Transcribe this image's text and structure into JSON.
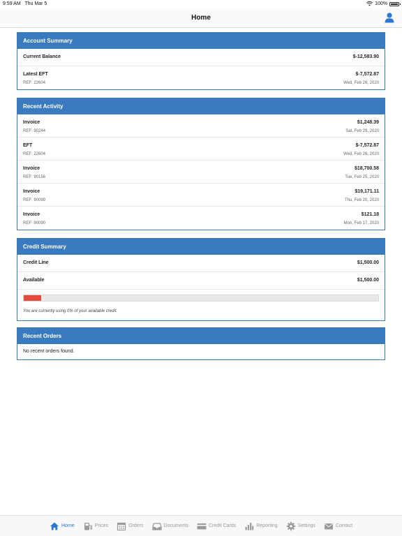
{
  "status_bar": {
    "time": "9:59 AM",
    "date": "Thu Mar 5",
    "battery": "100%"
  },
  "header": {
    "title": "Home"
  },
  "account_summary": {
    "title": "Account Summary",
    "current_balance_label": "Current Balance",
    "current_balance_value": "$-12,583.90",
    "latest_eft_label": "Latest EFT",
    "latest_eft_value": "$-7,572.87",
    "latest_eft_ref": "REF: 22604",
    "latest_eft_date": "Wed, Feb 26, 2020"
  },
  "recent_activity": {
    "title": "Recent Activity",
    "items": [
      {
        "type": "Invoice",
        "amount": "$1,248.39",
        "ref": "REF: 90244",
        "date": "Sat, Feb 29, 2020"
      },
      {
        "type": "EFT",
        "amount": "$-7,572.87",
        "ref": "REF: 22604",
        "date": "Wed, Feb 26, 2020"
      },
      {
        "type": "Invoice",
        "amount": "$18,700.58",
        "ref": "REF: 90156",
        "date": "Tue, Feb 25, 2020"
      },
      {
        "type": "Invoice",
        "amount": "$19,171.11",
        "ref": "REF: 90099",
        "date": "Thu, Feb 20, 2020"
      },
      {
        "type": "Invoice",
        "amount": "$121.18",
        "ref": "REF: 90090",
        "date": "Mon, Feb 17, 2020"
      }
    ]
  },
  "credit_summary": {
    "title": "Credit Summary",
    "credit_line_label": "Credit Line",
    "credit_line_value": "$1,500.00",
    "available_label": "Available",
    "available_value": "$1,500.00",
    "usage_fraction": 0.05,
    "usage_note": "You are currently using 0% of your available credit.",
    "bar_color": "#e64a3b"
  },
  "recent_orders": {
    "title": "Recent Orders",
    "empty_text": "No recent orders found."
  },
  "tabs": [
    {
      "label": "Home",
      "icon": "home-icon",
      "active": true
    },
    {
      "label": "Prices",
      "icon": "fuel-pump-icon",
      "active": false
    },
    {
      "label": "Orders",
      "icon": "calendar-icon",
      "active": false
    },
    {
      "label": "Documents",
      "icon": "inbox-icon",
      "active": false
    },
    {
      "label": "Credit Cards",
      "icon": "credit-card-icon",
      "active": false
    },
    {
      "label": "Reporting",
      "icon": "bar-chart-icon",
      "active": false
    },
    {
      "label": "Settings",
      "icon": "gear-icon",
      "active": false
    },
    {
      "label": "Contact",
      "icon": "envelope-icon",
      "active": false
    }
  ],
  "colors": {
    "accent": "#3a7bbf",
    "active_tab": "#2a77d4",
    "inactive_tab": "#9a9a9a"
  }
}
